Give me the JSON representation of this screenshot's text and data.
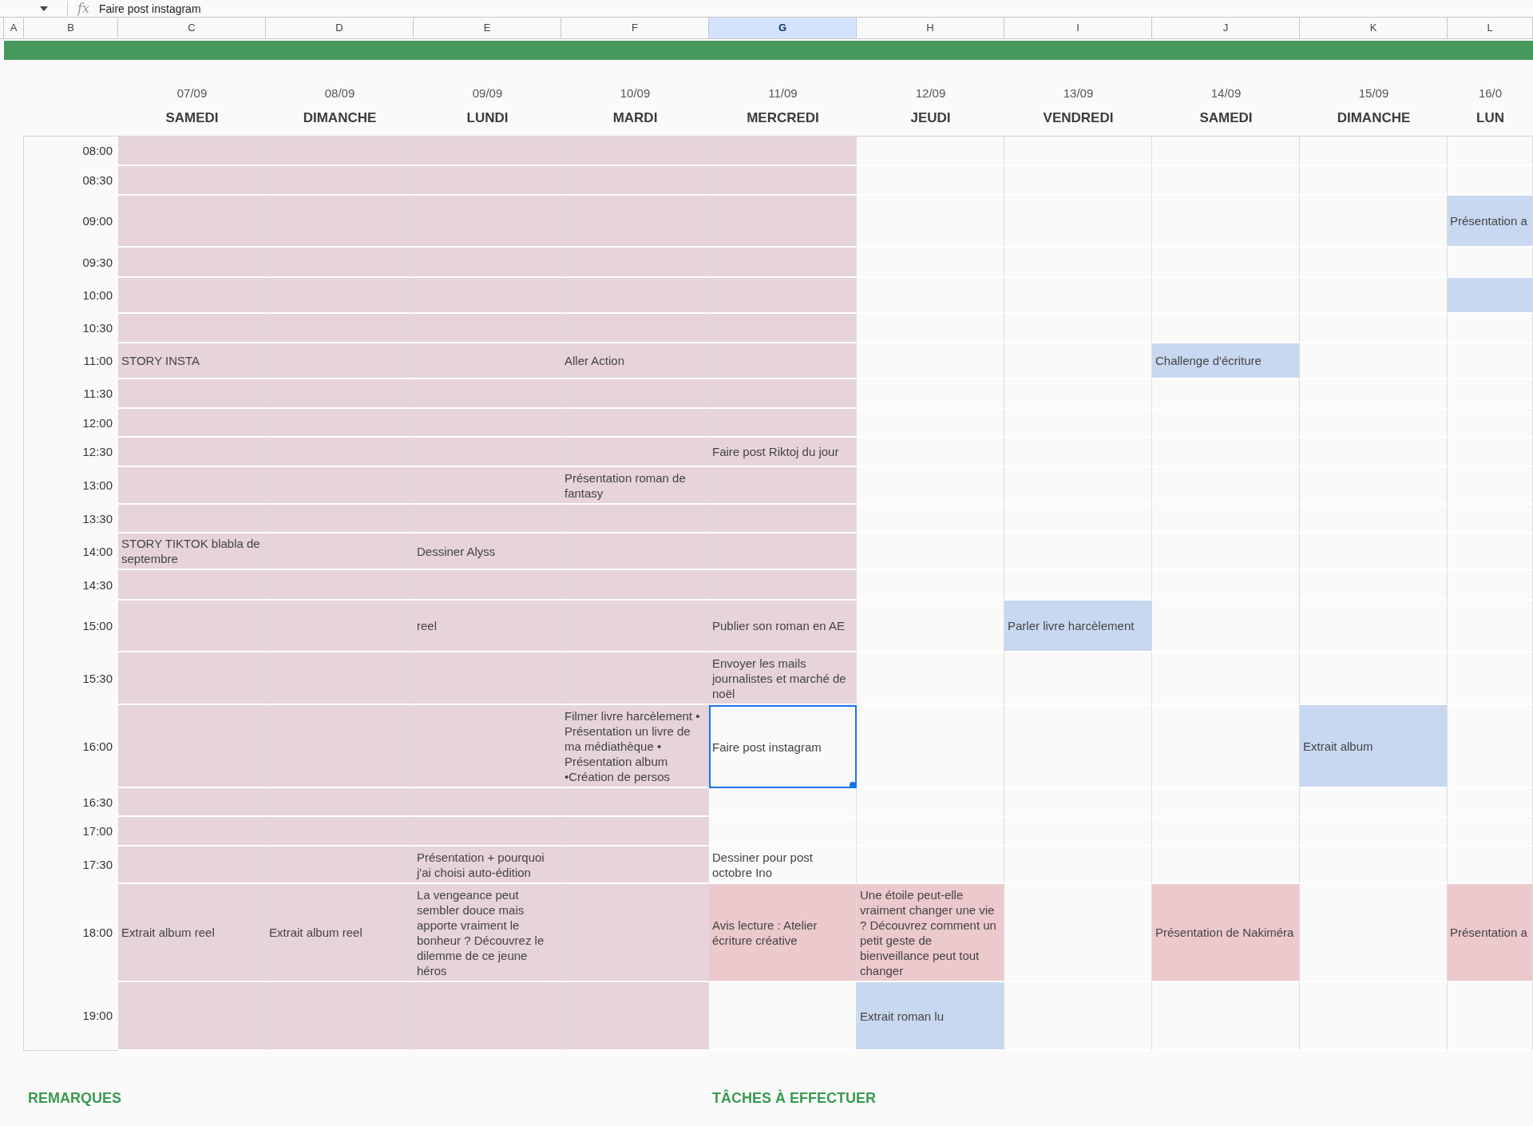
{
  "formula_bar": {
    "fx_label": "fx",
    "value": "Faire post instagram"
  },
  "column_headers": [
    {
      "label": "A",
      "selected": false
    },
    {
      "label": "B",
      "selected": false
    },
    {
      "label": "C",
      "selected": false
    },
    {
      "label": "D",
      "selected": false
    },
    {
      "label": "E",
      "selected": false
    },
    {
      "label": "F",
      "selected": false
    },
    {
      "label": "G",
      "selected": true
    },
    {
      "label": "H",
      "selected": false
    },
    {
      "label": "I",
      "selected": false
    },
    {
      "label": "J",
      "selected": false
    },
    {
      "label": "K",
      "selected": false
    },
    {
      "label": "L",
      "selected": false
    }
  ],
  "days": [
    {
      "date": "07/09",
      "day": "SAMEDI"
    },
    {
      "date": "08/09",
      "day": "DIMANCHE"
    },
    {
      "date": "09/09",
      "day": "LUNDI"
    },
    {
      "date": "10/09",
      "day": "MARDI"
    },
    {
      "date": "11/09",
      "day": "MERCREDI"
    },
    {
      "date": "12/09",
      "day": "JEUDI"
    },
    {
      "date": "13/09",
      "day": "VENDREDI"
    },
    {
      "date": "14/09",
      "day": "SAMEDI"
    },
    {
      "date": "15/09",
      "day": "DIMANCHE"
    },
    {
      "date": "16/0",
      "day": "LUN"
    }
  ],
  "rows": [
    {
      "time": "08:00",
      "cells": [
        {
          "color": "#e6d3dc",
          "selected": false
        },
        {
          "color": "#e6d3dc",
          "selected": false
        },
        {
          "color": "#e6d3dc",
          "selected": false
        },
        {
          "color": "#e6d3dc",
          "selected": false
        },
        {
          "color": "#e6d3dc",
          "selected": false
        },
        {
          "selected": false
        },
        {
          "selected": false
        },
        {
          "selected": false
        },
        {
          "selected": false
        },
        {
          "selected": false
        }
      ]
    },
    {
      "time": "08:30",
      "cells": [
        {
          "color": "#e6d3dc",
          "selected": false
        },
        {
          "color": "#e6d3dc",
          "selected": false
        },
        {
          "color": "#e6d3dc",
          "selected": false
        },
        {
          "color": "#e6d3dc",
          "selected": false
        },
        {
          "color": "#e6d3dc",
          "selected": false
        },
        {
          "selected": false
        },
        {
          "selected": false
        },
        {
          "selected": false
        },
        {
          "selected": false
        },
        {
          "selected": false
        }
      ]
    },
    {
      "time": "09:00",
      "cells": [
        {
          "color": "#e6d3dc",
          "selected": false
        },
        {
          "color": "#e6d3dc",
          "selected": false
        },
        {
          "color": "#e6d3dc",
          "selected": false
        },
        {
          "color": "#e6d3dc",
          "selected": false
        },
        {
          "color": "#e6d3dc",
          "selected": false
        },
        {
          "selected": false
        },
        {
          "selected": false
        },
        {
          "selected": false
        },
        {
          "selected": false
        },
        {
          "text": "Présentation a",
          "color": "#c9d8f1",
          "selected": false
        }
      ]
    },
    {
      "time": "09:30",
      "cells": [
        {
          "color": "#e6d3dc",
          "selected": false
        },
        {
          "color": "#e6d3dc",
          "selected": false
        },
        {
          "color": "#e6d3dc",
          "selected": false
        },
        {
          "color": "#e6d3dc",
          "selected": false
        },
        {
          "color": "#e6d3dc",
          "selected": false
        },
        {
          "selected": false
        },
        {
          "selected": false
        },
        {
          "selected": false
        },
        {
          "selected": false
        },
        {
          "selected": false
        }
      ]
    },
    {
      "time": "10:00",
      "cells": [
        {
          "color": "#e6d3dc",
          "selected": false
        },
        {
          "color": "#e6d3dc",
          "selected": false
        },
        {
          "color": "#e6d3dc",
          "selected": false
        },
        {
          "color": "#e6d3dc",
          "selected": false
        },
        {
          "color": "#e6d3dc",
          "selected": false
        },
        {
          "selected": false
        },
        {
          "selected": false
        },
        {
          "selected": false
        },
        {
          "selected": false
        },
        {
          "color": "#c9d8f1",
          "selected": false
        }
      ]
    },
    {
      "time": "10:30",
      "cells": [
        {
          "color": "#e6d3dc",
          "selected": false
        },
        {
          "color": "#e6d3dc",
          "selected": false
        },
        {
          "color": "#e6d3dc",
          "selected": false
        },
        {
          "color": "#e6d3dc",
          "selected": false
        },
        {
          "color": "#e6d3dc",
          "selected": false
        },
        {
          "selected": false
        },
        {
          "selected": false
        },
        {
          "selected": false
        },
        {
          "selected": false
        },
        {
          "selected": false
        }
      ]
    },
    {
      "time": "11:00",
      "cells": [
        {
          "text": "STORY INSTA",
          "color": "#e6d3dc",
          "selected": false
        },
        {
          "color": "#e6d3dc",
          "selected": false
        },
        {
          "color": "#e6d3dc",
          "selected": false
        },
        {
          "text": "Aller Action",
          "color": "#e6d3dc",
          "selected": false
        },
        {
          "color": "#e6d3dc",
          "selected": false
        },
        {
          "selected": false
        },
        {
          "selected": false
        },
        {
          "text": "Challenge d'écriture",
          "color": "#c9d8f1",
          "selected": false
        },
        {
          "selected": false
        },
        {
          "selected": false
        }
      ]
    },
    {
      "time": "11:30",
      "cells": [
        {
          "color": "#e6d3dc",
          "selected": false
        },
        {
          "color": "#e6d3dc",
          "selected": false
        },
        {
          "color": "#e6d3dc",
          "selected": false
        },
        {
          "color": "#e6d3dc",
          "selected": false
        },
        {
          "color": "#e6d3dc",
          "selected": false
        },
        {
          "selected": false
        },
        {
          "selected": false
        },
        {
          "selected": false
        },
        {
          "selected": false
        },
        {
          "selected": false
        }
      ]
    },
    {
      "time": "12:00",
      "cells": [
        {
          "color": "#e6d3dc",
          "selected": false
        },
        {
          "color": "#e6d3dc",
          "selected": false
        },
        {
          "color": "#e6d3dc",
          "selected": false
        },
        {
          "color": "#e6d3dc",
          "selected": false
        },
        {
          "color": "#e6d3dc",
          "selected": false
        },
        {
          "selected": false
        },
        {
          "selected": false
        },
        {
          "selected": false
        },
        {
          "selected": false
        },
        {
          "selected": false
        }
      ]
    },
    {
      "time": "12:30",
      "cells": [
        {
          "color": "#e6d3dc",
          "selected": false
        },
        {
          "color": "#e6d3dc",
          "selected": false
        },
        {
          "color": "#e6d3dc",
          "selected": false
        },
        {
          "color": "#e6d3dc",
          "selected": false
        },
        {
          "text": "Faire post Riktoj du jour",
          "color": "#e6d3dc",
          "selected": false
        },
        {
          "selected": false
        },
        {
          "selected": false
        },
        {
          "selected": false
        },
        {
          "selected": false
        },
        {
          "selected": false
        }
      ]
    },
    {
      "time": "13:00",
      "cells": [
        {
          "color": "#e6d3dc",
          "selected": false
        },
        {
          "color": "#e6d3dc",
          "selected": false
        },
        {
          "color": "#e6d3dc",
          "selected": false
        },
        {
          "text": "Présentation roman de fantasy",
          "color": "#e6d3dc",
          "selected": false
        },
        {
          "color": "#e6d3dc",
          "selected": false
        },
        {
          "selected": false
        },
        {
          "selected": false
        },
        {
          "selected": false
        },
        {
          "selected": false
        },
        {
          "selected": false
        }
      ]
    },
    {
      "time": "13:30",
      "cells": [
        {
          "color": "#e6d3dc",
          "selected": false
        },
        {
          "color": "#e6d3dc",
          "selected": false
        },
        {
          "color": "#e6d3dc",
          "selected": false
        },
        {
          "color": "#e6d3dc",
          "selected": false
        },
        {
          "color": "#e6d3dc",
          "selected": false
        },
        {
          "selected": false
        },
        {
          "selected": false
        },
        {
          "selected": false
        },
        {
          "selected": false
        },
        {
          "selected": false
        }
      ]
    },
    {
      "time": "14:00",
      "cells": [
        {
          "text": "STORY TIKTOK blabla de septembre",
          "color": "#e6d3dc",
          "selected": false
        },
        {
          "color": "#e6d3dc",
          "selected": false
        },
        {
          "text": "Dessiner Alyss",
          "color": "#e6d3dc",
          "selected": false
        },
        {
          "color": "#e6d3dc",
          "selected": false
        },
        {
          "color": "#e6d3dc",
          "selected": false
        },
        {
          "selected": false
        },
        {
          "selected": false
        },
        {
          "selected": false
        },
        {
          "selected": false
        },
        {
          "selected": false
        }
      ]
    },
    {
      "time": "14:30",
      "cells": [
        {
          "color": "#e6d3dc",
          "selected": false
        },
        {
          "color": "#e6d3dc",
          "selected": false
        },
        {
          "color": "#e6d3dc",
          "selected": false
        },
        {
          "color": "#e6d3dc",
          "selected": false
        },
        {
          "color": "#e6d3dc",
          "selected": false
        },
        {
          "selected": false
        },
        {
          "selected": false
        },
        {
          "selected": false
        },
        {
          "selected": false
        },
        {
          "selected": false
        }
      ]
    },
    {
      "time": "15:00",
      "cells": [
        {
          "color": "#e6d3dc",
          "selected": false
        },
        {
          "color": "#e6d3dc",
          "selected": false
        },
        {
          "text": "reel",
          "color": "#e6d3dc",
          "selected": false
        },
        {
          "color": "#e6d3dc",
          "selected": false
        },
        {
          "text": "Publier son roman en AE",
          "color": "#e6d3dc",
          "selected": false
        },
        {
          "selected": false
        },
        {
          "text": "Parler livre harcèlement",
          "color": "#c9d8f1",
          "selected": false
        },
        {
          "selected": false
        },
        {
          "selected": false
        },
        {
          "selected": false
        }
      ]
    },
    {
      "time": "15:30",
      "cells": [
        {
          "color": "#e6d3dc",
          "selected": false
        },
        {
          "color": "#e6d3dc",
          "selected": false
        },
        {
          "color": "#e6d3dc",
          "selected": false
        },
        {
          "color": "#e6d3dc",
          "selected": false
        },
        {
          "text": "Envoyer les mails journalistes et marché de noël",
          "color": "#e6d3dc",
          "selected": false
        },
        {
          "selected": false
        },
        {
          "selected": false
        },
        {
          "selected": false
        },
        {
          "selected": false
        },
        {
          "selected": false
        }
      ]
    },
    {
      "time": "16:00",
      "cells": [
        {
          "color": "#e6d3dc",
          "selected": false
        },
        {
          "color": "#e6d3dc",
          "selected": false
        },
        {
          "color": "#e6d3dc",
          "selected": false
        },
        {
          "text": "Filmer livre harcèlement • Présentation un livre de ma médiathèque • Présentation album •Création de persos",
          "color": "#e6d3dc",
          "selected": false
        },
        {
          "text": "Faire post instagram",
          "selected": true
        },
        {
          "selected": false
        },
        {
          "selected": false
        },
        {
          "selected": false
        },
        {
          "text": "Extrait album",
          "color": "#c9d8f1",
          "selected": false
        },
        {
          "selected": false
        }
      ]
    },
    {
      "time": "16:30",
      "cells": [
        {
          "color": "#e6d3dc",
          "selected": false
        },
        {
          "color": "#e6d3dc",
          "selected": false
        },
        {
          "color": "#e6d3dc",
          "selected": false
        },
        {
          "color": "#e6d3dc",
          "selected": false
        },
        {
          "selected": false
        },
        {
          "selected": false
        },
        {
          "selected": false
        },
        {
          "selected": false
        },
        {
          "selected": false
        },
        {
          "selected": false
        }
      ]
    },
    {
      "time": "17:00",
      "cells": [
        {
          "color": "#e6d3dc",
          "selected": false
        },
        {
          "color": "#e6d3dc",
          "selected": false
        },
        {
          "color": "#e6d3dc",
          "selected": false
        },
        {
          "color": "#e6d3dc",
          "selected": false
        },
        {
          "selected": false
        },
        {
          "selected": false
        },
        {
          "selected": false
        },
        {
          "selected": false
        },
        {
          "selected": false
        },
        {
          "selected": false
        }
      ]
    },
    {
      "time": "17:30",
      "cells": [
        {
          "color": "#e6d3dc",
          "selected": false
        },
        {
          "color": "#e6d3dc",
          "selected": false
        },
        {
          "text": "Présentation + pourquoi j'ai choisi auto-édition",
          "color": "#e6d3dc",
          "selected": false
        },
        {
          "color": "#e6d3dc",
          "selected": false
        },
        {
          "text": "Dessiner pour post octobre Ino",
          "selected": false
        },
        {
          "selected": false
        },
        {
          "selected": false
        },
        {
          "selected": false
        },
        {
          "selected": false
        },
        {
          "selected": false
        }
      ]
    },
    {
      "time": "18:00",
      "cells": [
        {
          "text": "Extrait album reel",
          "color": "#e6d3dc",
          "selected": false
        },
        {
          "text": "Extrait album reel",
          "color": "#e6d3dc",
          "selected": false
        },
        {
          "text": "La vengeance peut sembler douce mais apporte vraiment le bonheur ? Découvrez le dilemme de ce jeune héros",
          "color": "#e6d3dc",
          "selected": false
        },
        {
          "color": "#e6d3dc",
          "selected": false
        },
        {
          "text": "Avis lecture : Atelier écriture créative",
          "color": "#ecc9cc",
          "selected": false
        },
        {
          "text": "Une étoile peut-elle vraiment changer une vie ? Découvrez comment un petit geste de bienveillance peut tout changer",
          "color": "#ecc9cc",
          "selected": false
        },
        {
          "selected": false
        },
        {
          "text": "Présentation de Nakiméra",
          "color": "#ecc9cc",
          "selected": false
        },
        {
          "selected": false
        },
        {
          "text": "Présentation a",
          "color": "#ecc9cc",
          "selected": false
        }
      ]
    },
    {
      "time": "19:00",
      "cells": [
        {
          "color": "#e6d3dc",
          "selected": false
        },
        {
          "color": "#e6d3dc",
          "selected": false
        },
        {
          "color": "#e6d3dc",
          "selected": false
        },
        {
          "color": "#e6d3dc",
          "selected": false
        },
        {
          "selected": false
        },
        {
          "text": "Extrait roman lu",
          "color": "#c9d8f1",
          "selected": false
        },
        {
          "selected": false
        },
        {
          "selected": false
        },
        {
          "selected": false
        },
        {
          "selected": false
        }
      ]
    }
  ],
  "sections": [
    {
      "title": "REMARQUES"
    },
    {
      "title": "TÂCHES À EFFECTUER"
    }
  ]
}
